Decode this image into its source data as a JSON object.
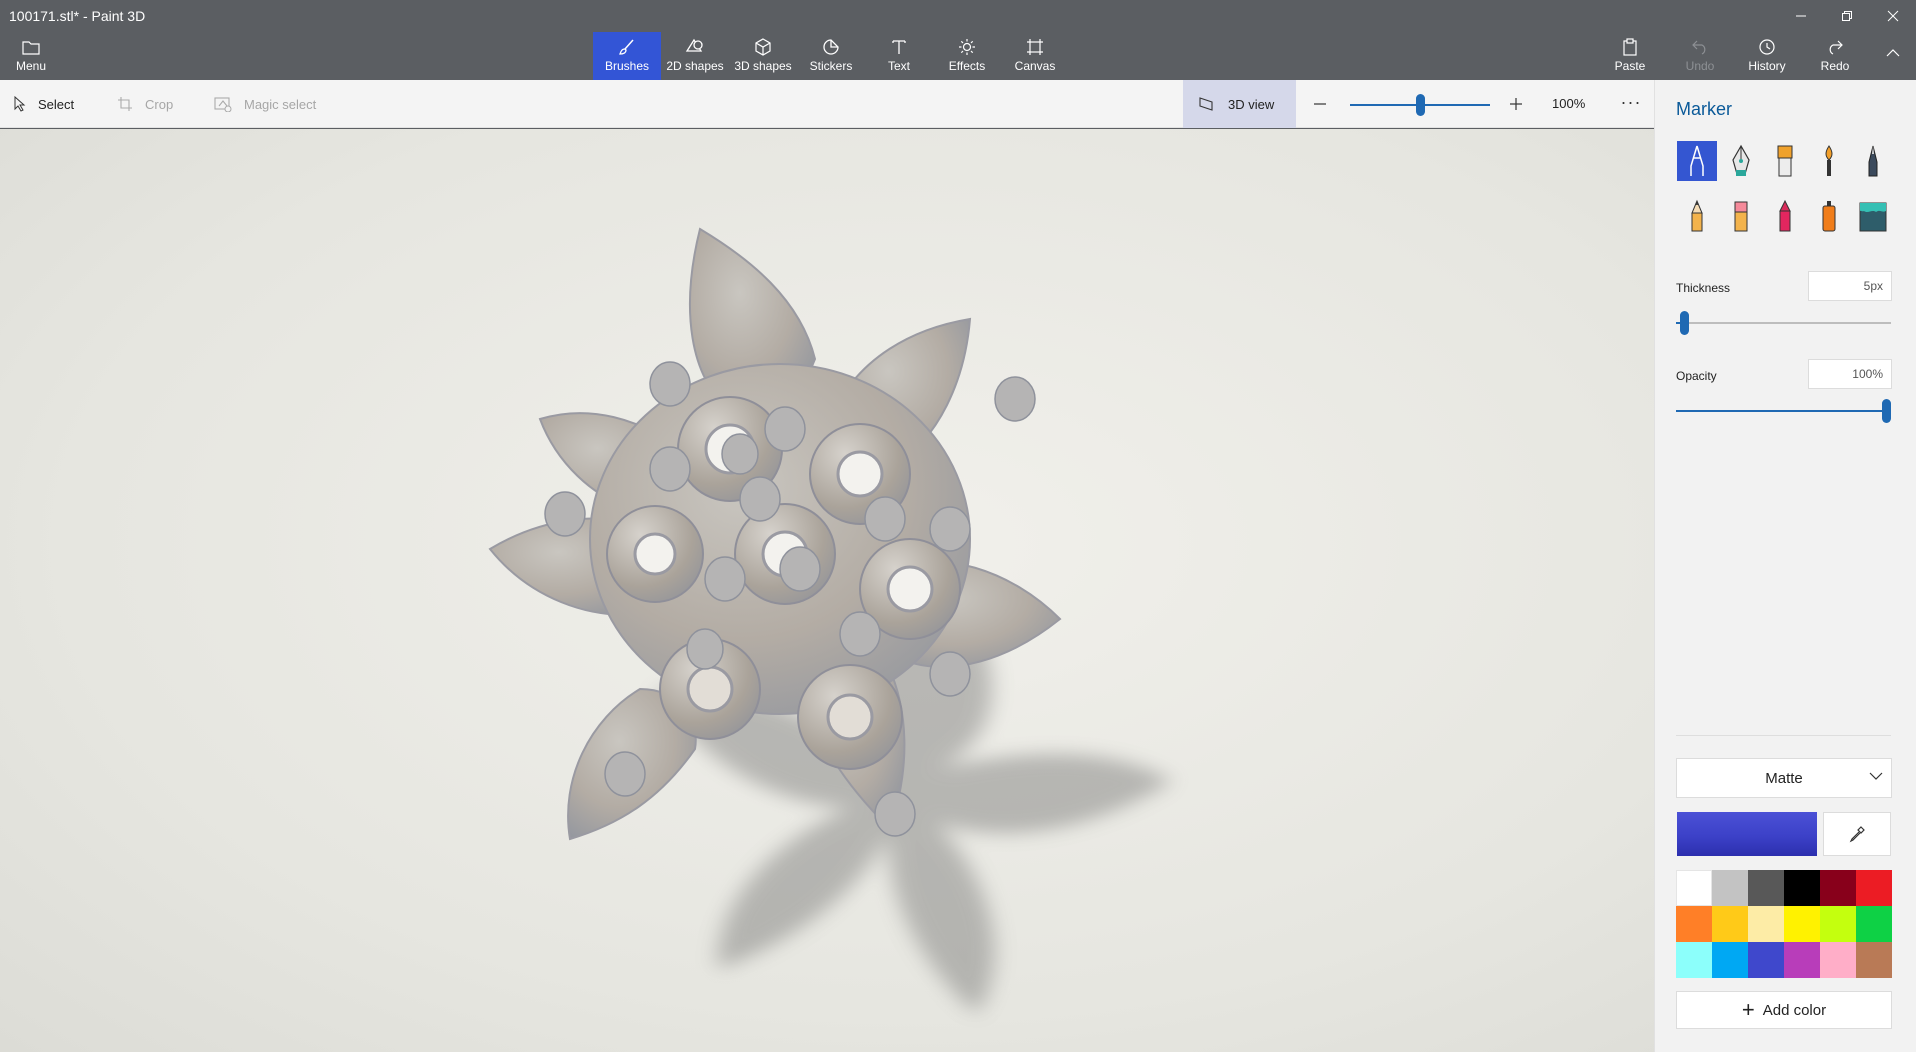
{
  "window": {
    "title": "100171.stl* - Paint 3D",
    "controls": {
      "minimize": "—",
      "restore": "❐",
      "close": "✕"
    }
  },
  "ribbon": {
    "menu": "Menu",
    "tools": [
      {
        "label": "Brushes",
        "icon": "brush-icon",
        "active": true
      },
      {
        "label": "2D shapes",
        "icon": "2d-shapes-icon"
      },
      {
        "label": "3D shapes",
        "icon": "3d-shapes-icon"
      },
      {
        "label": "Stickers",
        "icon": "stickers-icon"
      },
      {
        "label": "Text",
        "icon": "text-icon"
      },
      {
        "label": "Effects",
        "icon": "effects-icon"
      },
      {
        "label": "Canvas",
        "icon": "canvas-icon"
      }
    ],
    "actions": {
      "paste": "Paste",
      "undo": "Undo",
      "history": "History",
      "redo": "Redo"
    }
  },
  "toolbar": {
    "select": "Select",
    "crop": "Crop",
    "magic_select": "Magic select",
    "view_3d": "3D view",
    "zoom_out": "—",
    "zoom_in": "+",
    "zoom_value": "100%",
    "zoom_level": 0.5,
    "more": "···"
  },
  "panel": {
    "title": "Marker",
    "brushes": [
      {
        "name": "marker",
        "icon": "marker-icon",
        "selected": true
      },
      {
        "name": "calligraphy-pen",
        "icon": "calligraphy-pen-icon"
      },
      {
        "name": "oil-brush",
        "icon": "oil-brush-icon"
      },
      {
        "name": "watercolor",
        "icon": "watercolor-icon"
      },
      {
        "name": "pixel-pen",
        "icon": "pixel-pen-icon"
      },
      {
        "name": "pencil",
        "icon": "pencil-icon"
      },
      {
        "name": "eraser",
        "icon": "eraser-icon"
      },
      {
        "name": "crayon",
        "icon": "crayon-icon"
      },
      {
        "name": "spray-can",
        "icon": "spray-can-icon"
      },
      {
        "name": "fill",
        "icon": "fill-bucket-icon"
      }
    ],
    "thickness": {
      "label": "Thickness",
      "value": "5px",
      "level": 0.02
    },
    "opacity": {
      "label": "Opacity",
      "value": "100%",
      "level": 1.0
    },
    "finish": "Matte",
    "current_color": "#3c41c8",
    "palette": [
      "#ffffff",
      "#c3c3c3",
      "#585858",
      "#000000",
      "#88001b",
      "#ec1c24",
      "#ff7f27",
      "#ffca18",
      "#fdeca6",
      "#fff200",
      "#c4ff0e",
      "#0ed145",
      "#8cfffb",
      "#00a8f3",
      "#3f48cc",
      "#b83dba",
      "#ffaec8",
      "#b97a56"
    ],
    "add_color": "Add color"
  },
  "colors": {
    "accent": "#3355d6",
    "title_bar": "#5b5e62",
    "slider": "#1f69b3"
  }
}
